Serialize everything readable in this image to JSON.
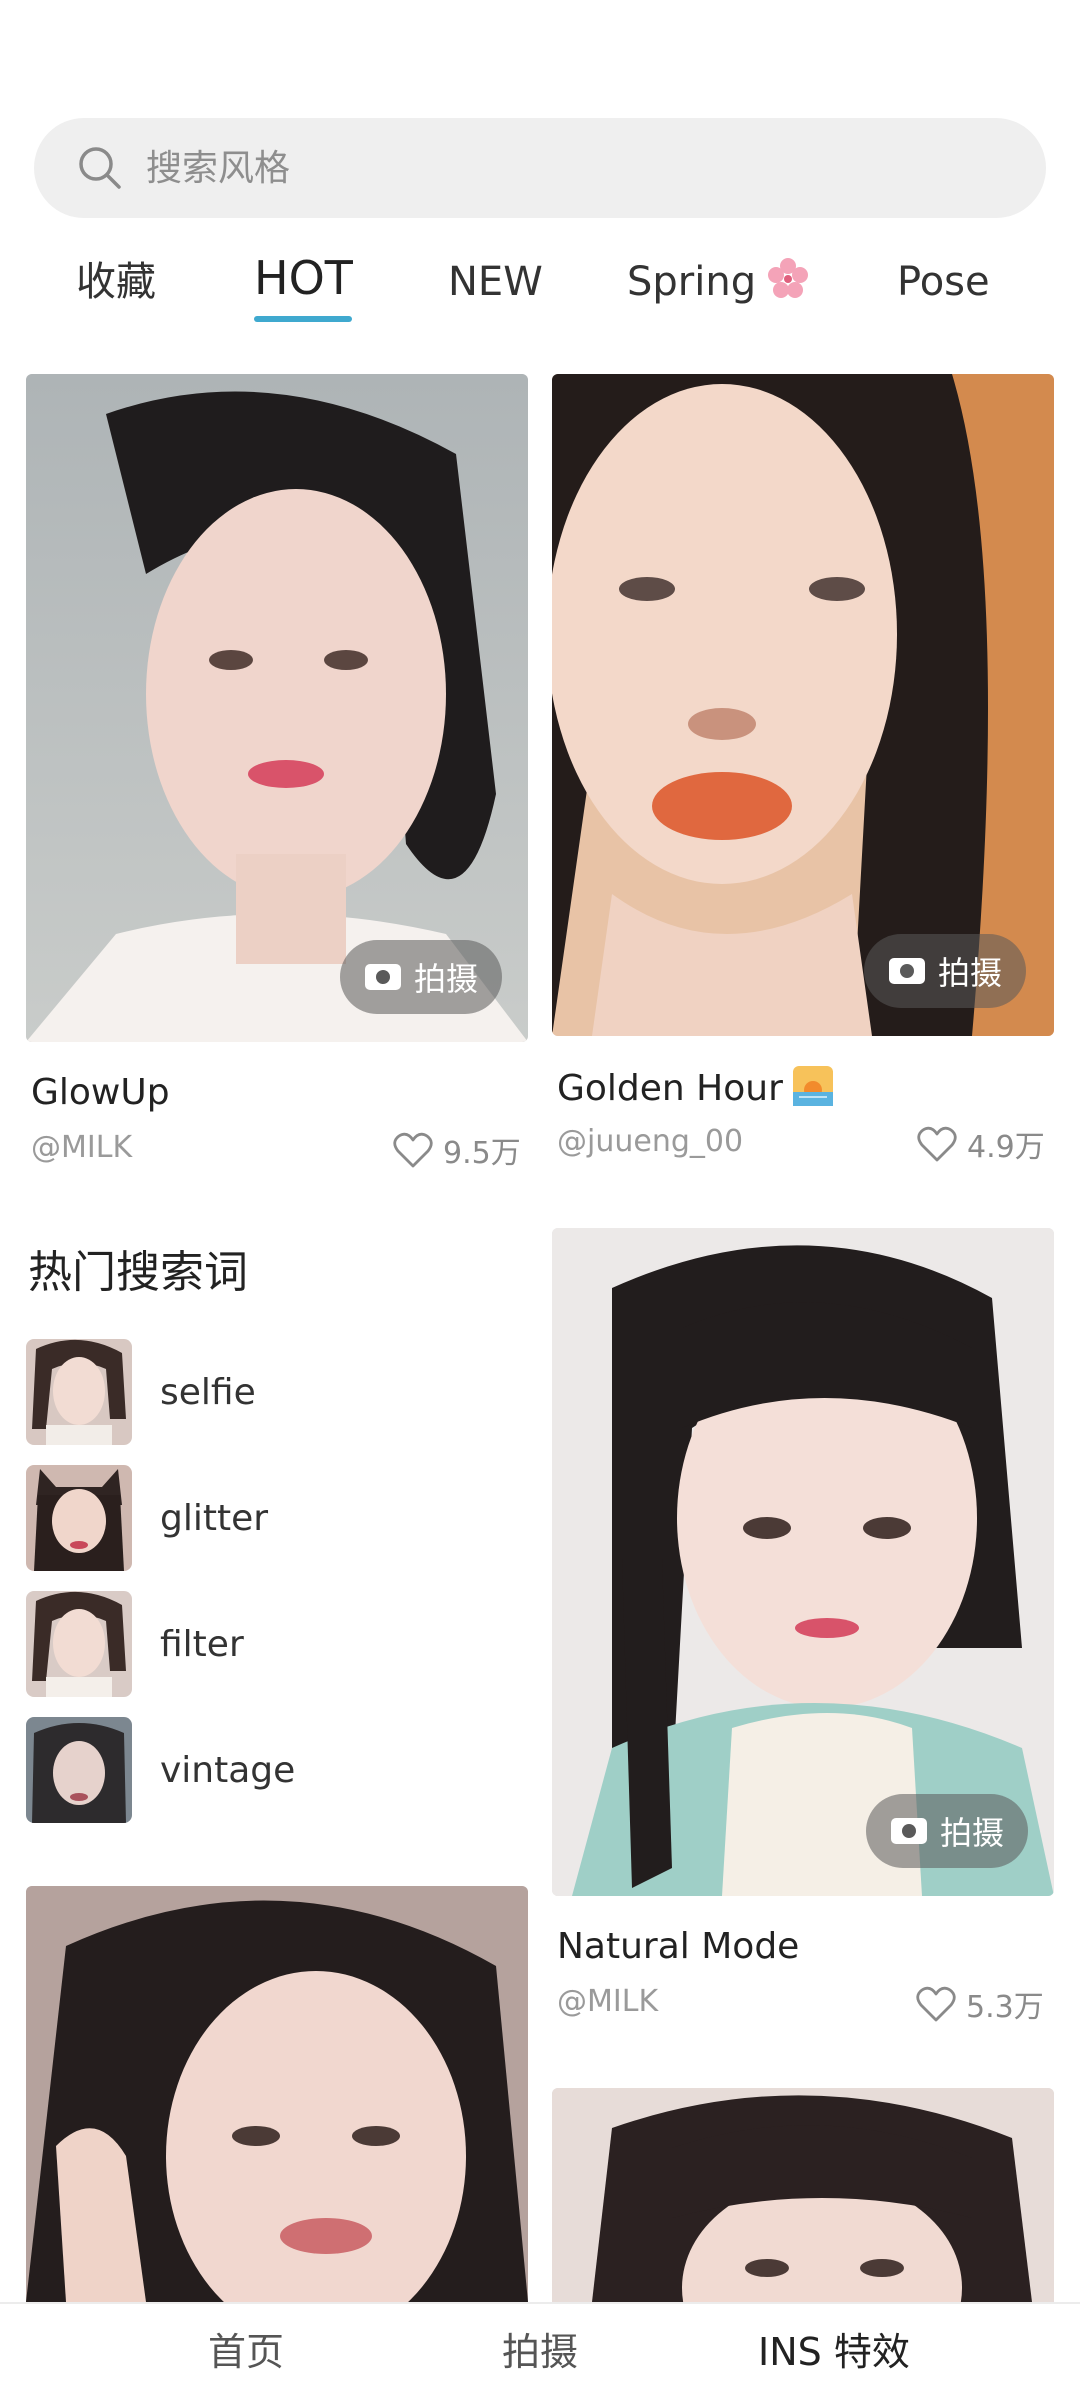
{
  "search": {
    "placeholder": "搜索风格"
  },
  "tabs": [
    {
      "label": "收藏",
      "active": false
    },
    {
      "label": "HOT",
      "active": true
    },
    {
      "label": "NEW",
      "active": false
    },
    {
      "label": "Spring",
      "active": false,
      "emoji": "cherry-blossom-icon"
    },
    {
      "label": "Pose",
      "active": false
    }
  ],
  "cards": [
    {
      "title": "GlowUp",
      "author": "@MILK",
      "likes": "9.5万",
      "shoot_label": "拍摄"
    },
    {
      "title": "Golden Hour",
      "emoji": "sunset-icon",
      "author": "@juueng_00",
      "likes": "4.9万",
      "shoot_label": "拍摄"
    },
    {
      "title": "Natural Mode",
      "author": "@MILK",
      "likes": "5.3万",
      "shoot_label": "拍摄"
    }
  ],
  "hot_searches": {
    "title": "热门搜索词",
    "items": [
      {
        "label": "selfie"
      },
      {
        "label": "glitter"
      },
      {
        "label": "filter"
      },
      {
        "label": "vintage"
      }
    ]
  },
  "bottom_nav": [
    {
      "label": "首页",
      "active": false
    },
    {
      "label": "拍摄",
      "active": false
    },
    {
      "label": "INS 特效",
      "active": true
    }
  ],
  "colors": {
    "accent": "#3fa9cf",
    "search_bg": "#efefef",
    "muted_text": "#9a9a9a"
  }
}
